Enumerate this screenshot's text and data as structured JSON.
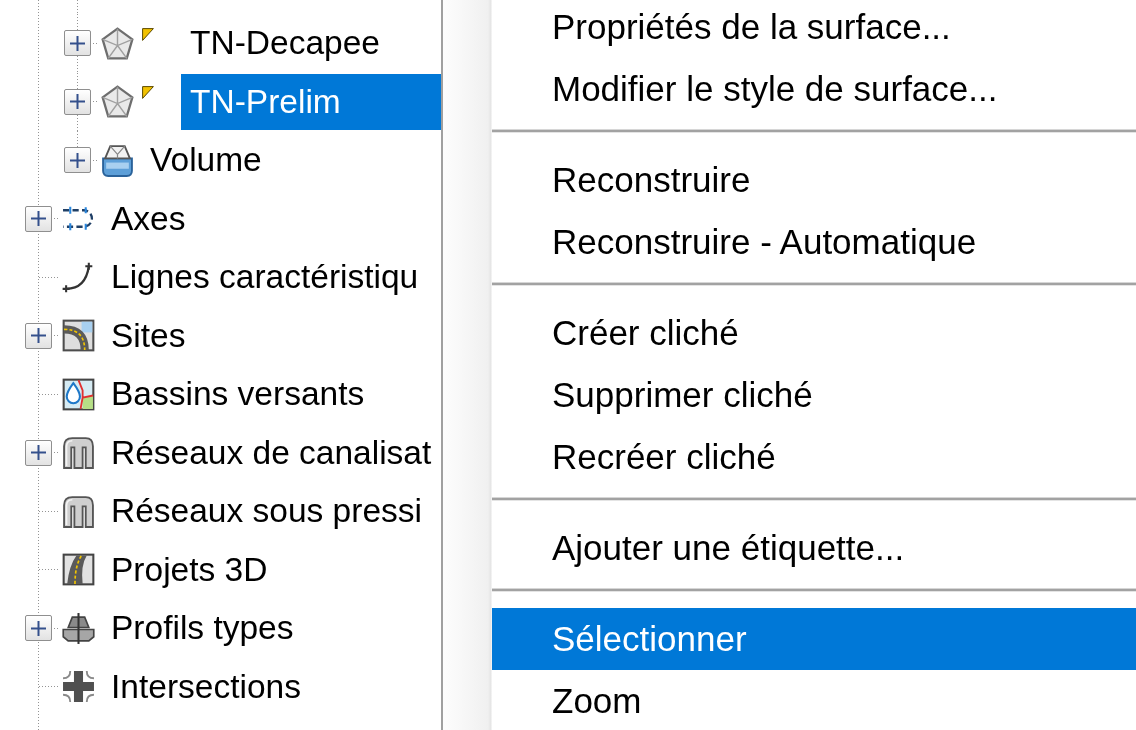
{
  "tree": {
    "items": [
      {
        "children": [
          {
            "label": "TN-Decapee",
            "kind": "surface",
            "expandable": true,
            "expanded": false,
            "flagged": true,
            "selected": false
          },
          {
            "label": "TN-Prelim",
            "kind": "surface",
            "expandable": true,
            "expanded": false,
            "flagged": true,
            "selected": true
          },
          {
            "label": "Volume",
            "kind": "volume",
            "expandable": true,
            "expanded": false,
            "flagged": false,
            "selected": false
          }
        ]
      },
      {
        "label": "Axes",
        "kind": "alignment",
        "expandable": true,
        "expanded": false,
        "flagged": false,
        "selected": false
      },
      {
        "label": "Lignes caractéristiqu",
        "kind": "feature-line",
        "expandable": false,
        "flagged": false,
        "selected": false
      },
      {
        "label": "Sites",
        "kind": "site",
        "expandable": true,
        "expanded": false,
        "flagged": false,
        "selected": false
      },
      {
        "label": "Bassins versants",
        "kind": "catchment",
        "expandable": false,
        "flagged": false,
        "selected": false
      },
      {
        "label": "Réseaux de canalisat",
        "kind": "pipe-network",
        "expandable": true,
        "expanded": false,
        "flagged": false,
        "selected": false
      },
      {
        "label": "Réseaux sous pressi",
        "kind": "pressure-network",
        "expandable": false,
        "flagged": false,
        "selected": false
      },
      {
        "label": "Projets 3D",
        "kind": "corridor",
        "expandable": false,
        "flagged": false,
        "selected": false
      },
      {
        "label": "Profils types",
        "kind": "assembly",
        "expandable": true,
        "expanded": false,
        "flagged": false,
        "selected": false
      },
      {
        "label": "Intersections",
        "kind": "intersection",
        "expandable": false,
        "flagged": false,
        "selected": false
      }
    ]
  },
  "context_menu": {
    "groups": [
      {
        "items": [
          {
            "label": "Propriétés de la surface...",
            "selected": false
          },
          {
            "label": "Modifier le style de surface...",
            "selected": false
          }
        ]
      },
      {
        "items": [
          {
            "label": "Reconstruire",
            "selected": false
          },
          {
            "label": "Reconstruire - Automatique",
            "selected": false
          }
        ]
      },
      {
        "items": [
          {
            "label": "Créer cliché",
            "selected": false
          },
          {
            "label": "Supprimer cliché",
            "selected": false
          },
          {
            "label": "Recréer cliché",
            "selected": false
          }
        ]
      },
      {
        "items": [
          {
            "label": "Ajouter une étiquette...",
            "selected": false
          }
        ]
      },
      {
        "items": [
          {
            "label": "Sélectionner",
            "selected": true
          },
          {
            "label": "Zoom",
            "selected": false
          }
        ]
      }
    ]
  }
}
